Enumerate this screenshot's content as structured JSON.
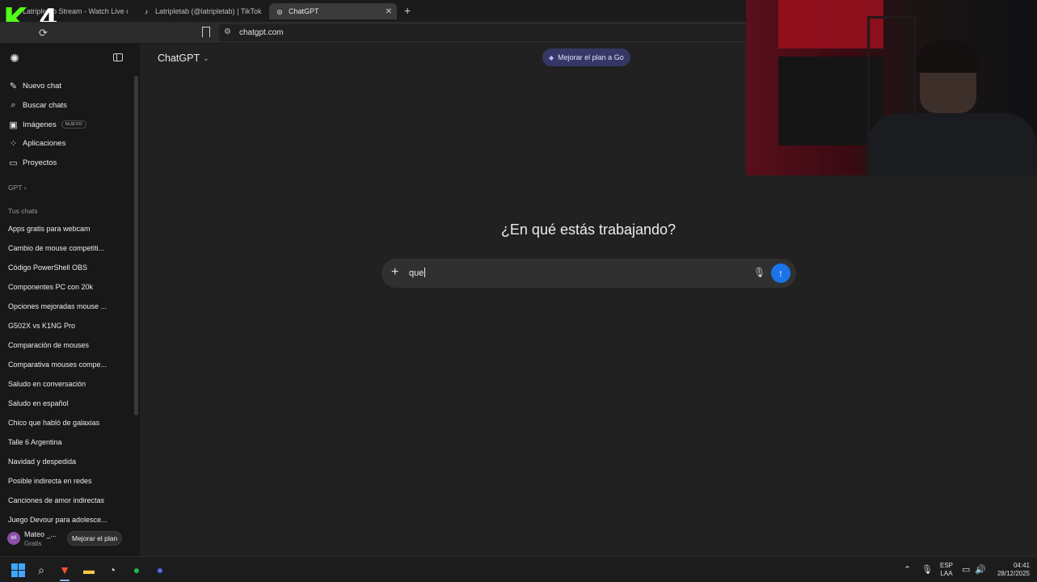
{
  "browser": {
    "tabs": [
      {
        "title": "Latripletab Stream - Watch Live on Kick",
        "icon": "kick-icon"
      },
      {
        "title": "Latripletab (@latripletab) | TikTok",
        "icon": "tiktok-icon"
      },
      {
        "title": "ChatGPT",
        "icon": "chatgpt-icon",
        "active": true
      }
    ],
    "url": "chatgpt.com"
  },
  "overlay": {
    "kick_logo_letter": "K",
    "kick_logo_number": "4"
  },
  "sidebar": {
    "nav": [
      {
        "label": "Nuevo chat",
        "icon": "edit-icon"
      },
      {
        "label": "Buscar chats",
        "icon": "search-icon"
      },
      {
        "label": "Imágenes",
        "icon": "image-icon",
        "badge": "NUEVO"
      },
      {
        "label": "Aplicaciones",
        "icon": "apps-icon"
      },
      {
        "label": "Proyectos",
        "icon": "folder-icon"
      }
    ],
    "gpt_label": "GPT",
    "chats_heading": "Tus chats",
    "chats": [
      "Apps gratis para webcam",
      "Cambio de mouse competiti...",
      "Código PowerShell OBS",
      "Componentes PC con 20k",
      "Opciones mejoradas mouse ...",
      "G502X vs K1NG Pro",
      "Comparación de mouses",
      "Comparativa mouses compe...",
      "Saludo en conversación",
      "Saludo en español",
      "Chico que habló de galaxias",
      "Talle 6 Argentina",
      "Navidad y despedida",
      "Posible indirecta en redes",
      "Canciones de amor indirectas",
      "Juego Devour para adolesce..."
    ],
    "user": {
      "initials": "MI",
      "name": "Mateo _...",
      "plan": "Gratis",
      "upgrade_label": "Mejorar el plan"
    }
  },
  "main": {
    "model": "ChatGPT",
    "upgrade_go": "Mejorar el plan a Go",
    "heading": "¿En qué estás trabajando?",
    "composer_value": "que"
  },
  "taskbar": {
    "lang_top": "ESP",
    "lang_bottom": "LAA",
    "time": "04:41",
    "date": "28/12/2025"
  },
  "colors": {
    "send_button": "#1a73e8",
    "kick_green": "#53fc18",
    "go_button": "#373765"
  }
}
